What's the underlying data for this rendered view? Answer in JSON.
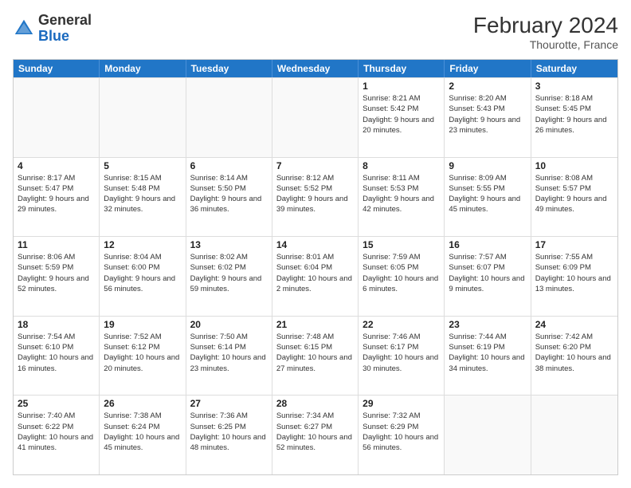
{
  "header": {
    "logo": {
      "general": "General",
      "blue": "Blue"
    },
    "title": "February 2024",
    "location": "Thourotte, France"
  },
  "days_of_week": [
    "Sunday",
    "Monday",
    "Tuesday",
    "Wednesday",
    "Thursday",
    "Friday",
    "Saturday"
  ],
  "weeks": [
    [
      {
        "day": "",
        "empty": true
      },
      {
        "day": "",
        "empty": true
      },
      {
        "day": "",
        "empty": true
      },
      {
        "day": "",
        "empty": true
      },
      {
        "day": "1",
        "sunrise": "8:21 AM",
        "sunset": "5:42 PM",
        "daylight": "9 hours and 20 minutes."
      },
      {
        "day": "2",
        "sunrise": "8:20 AM",
        "sunset": "5:43 PM",
        "daylight": "9 hours and 23 minutes."
      },
      {
        "day": "3",
        "sunrise": "8:18 AM",
        "sunset": "5:45 PM",
        "daylight": "9 hours and 26 minutes."
      }
    ],
    [
      {
        "day": "4",
        "sunrise": "8:17 AM",
        "sunset": "5:47 PM",
        "daylight": "9 hours and 29 minutes."
      },
      {
        "day": "5",
        "sunrise": "8:15 AM",
        "sunset": "5:48 PM",
        "daylight": "9 hours and 32 minutes."
      },
      {
        "day": "6",
        "sunrise": "8:14 AM",
        "sunset": "5:50 PM",
        "daylight": "9 hours and 36 minutes."
      },
      {
        "day": "7",
        "sunrise": "8:12 AM",
        "sunset": "5:52 PM",
        "daylight": "9 hours and 39 minutes."
      },
      {
        "day": "8",
        "sunrise": "8:11 AM",
        "sunset": "5:53 PM",
        "daylight": "9 hours and 42 minutes."
      },
      {
        "day": "9",
        "sunrise": "8:09 AM",
        "sunset": "5:55 PM",
        "daylight": "9 hours and 45 minutes."
      },
      {
        "day": "10",
        "sunrise": "8:08 AM",
        "sunset": "5:57 PM",
        "daylight": "9 hours and 49 minutes."
      }
    ],
    [
      {
        "day": "11",
        "sunrise": "8:06 AM",
        "sunset": "5:59 PM",
        "daylight": "9 hours and 52 minutes."
      },
      {
        "day": "12",
        "sunrise": "8:04 AM",
        "sunset": "6:00 PM",
        "daylight": "9 hours and 56 minutes."
      },
      {
        "day": "13",
        "sunrise": "8:02 AM",
        "sunset": "6:02 PM",
        "daylight": "9 hours and 59 minutes."
      },
      {
        "day": "14",
        "sunrise": "8:01 AM",
        "sunset": "6:04 PM",
        "daylight": "10 hours and 2 minutes."
      },
      {
        "day": "15",
        "sunrise": "7:59 AM",
        "sunset": "6:05 PM",
        "daylight": "10 hours and 6 minutes."
      },
      {
        "day": "16",
        "sunrise": "7:57 AM",
        "sunset": "6:07 PM",
        "daylight": "10 hours and 9 minutes."
      },
      {
        "day": "17",
        "sunrise": "7:55 AM",
        "sunset": "6:09 PM",
        "daylight": "10 hours and 13 minutes."
      }
    ],
    [
      {
        "day": "18",
        "sunrise": "7:54 AM",
        "sunset": "6:10 PM",
        "daylight": "10 hours and 16 minutes."
      },
      {
        "day": "19",
        "sunrise": "7:52 AM",
        "sunset": "6:12 PM",
        "daylight": "10 hours and 20 minutes."
      },
      {
        "day": "20",
        "sunrise": "7:50 AM",
        "sunset": "6:14 PM",
        "daylight": "10 hours and 23 minutes."
      },
      {
        "day": "21",
        "sunrise": "7:48 AM",
        "sunset": "6:15 PM",
        "daylight": "10 hours and 27 minutes."
      },
      {
        "day": "22",
        "sunrise": "7:46 AM",
        "sunset": "6:17 PM",
        "daylight": "10 hours and 30 minutes."
      },
      {
        "day": "23",
        "sunrise": "7:44 AM",
        "sunset": "6:19 PM",
        "daylight": "10 hours and 34 minutes."
      },
      {
        "day": "24",
        "sunrise": "7:42 AM",
        "sunset": "6:20 PM",
        "daylight": "10 hours and 38 minutes."
      }
    ],
    [
      {
        "day": "25",
        "sunrise": "7:40 AM",
        "sunset": "6:22 PM",
        "daylight": "10 hours and 41 minutes."
      },
      {
        "day": "26",
        "sunrise": "7:38 AM",
        "sunset": "6:24 PM",
        "daylight": "10 hours and 45 minutes."
      },
      {
        "day": "27",
        "sunrise": "7:36 AM",
        "sunset": "6:25 PM",
        "daylight": "10 hours and 48 minutes."
      },
      {
        "day": "28",
        "sunrise": "7:34 AM",
        "sunset": "6:27 PM",
        "daylight": "10 hours and 52 minutes."
      },
      {
        "day": "29",
        "sunrise": "7:32 AM",
        "sunset": "6:29 PM",
        "daylight": "10 hours and 56 minutes."
      },
      {
        "day": "",
        "empty": true
      },
      {
        "day": "",
        "empty": true
      }
    ]
  ]
}
